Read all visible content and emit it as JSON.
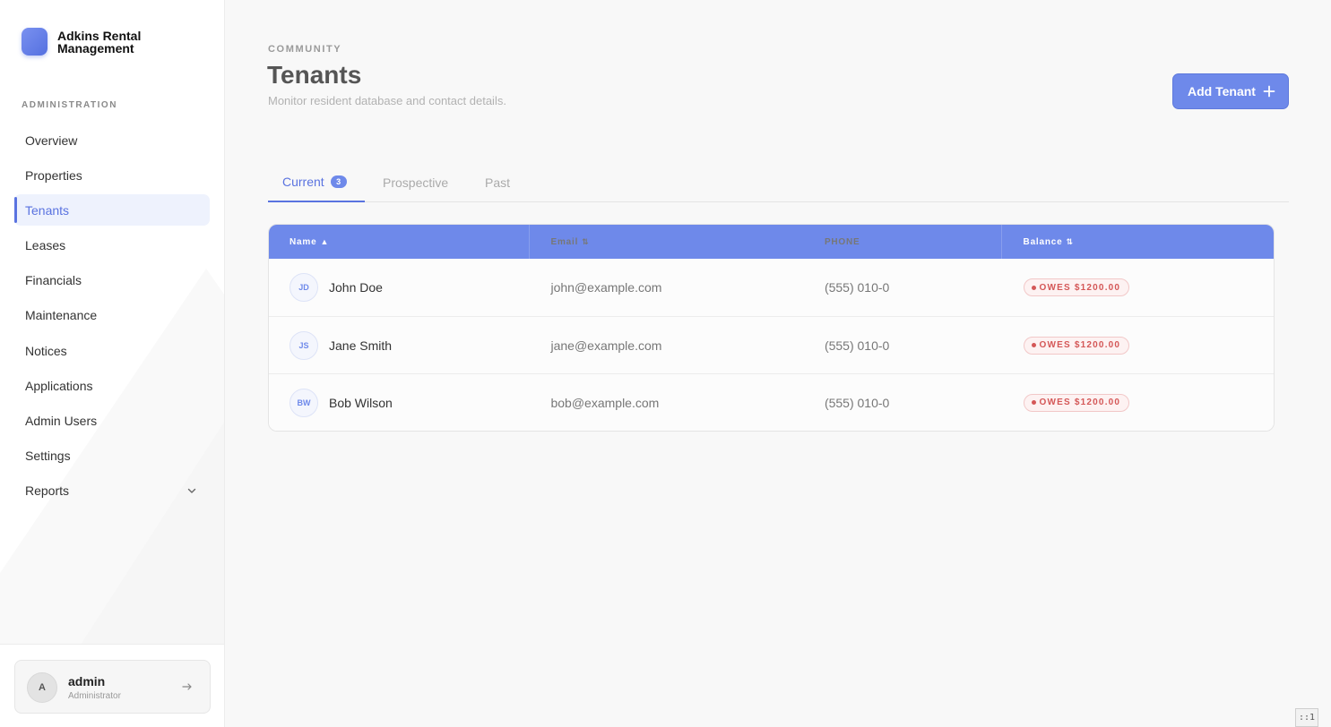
{
  "brand": {
    "name": "Adkins Rental Management"
  },
  "sidebar": {
    "section_label": "ADMINISTRATION",
    "items": [
      {
        "label": "Overview"
      },
      {
        "label": "Properties"
      },
      {
        "label": "Tenants",
        "active": true
      },
      {
        "label": "Leases"
      },
      {
        "label": "Financials"
      },
      {
        "label": "Maintenance"
      },
      {
        "label": "Notices"
      },
      {
        "label": "Applications"
      },
      {
        "label": "Admin Users"
      },
      {
        "label": "Settings"
      },
      {
        "label": "Reports",
        "icon": "chevron-down-icon"
      }
    ]
  },
  "user": {
    "initial": "A",
    "name": "admin",
    "role": "Administrator",
    "logout_icon": "arrow-right-icon"
  },
  "header": {
    "eyebrow": "COMMUNITY",
    "title": "Tenants",
    "subtitle": "Monitor resident database and contact details.",
    "add_button_label": "Add Tenant",
    "add_button_icon": "plus-icon"
  },
  "tabs": [
    {
      "label": "Current",
      "badge": "3",
      "active": true
    },
    {
      "label": "Prospective"
    },
    {
      "label": "Past"
    }
  ],
  "table": {
    "columns": [
      {
        "label": "Name",
        "sort": "▲"
      },
      {
        "label": "Email",
        "sort": "⇅"
      },
      {
        "label": "PHONE"
      },
      {
        "label": "Balance",
        "sort": "⇅"
      }
    ],
    "rows": [
      {
        "initials": "JD",
        "name": "John Doe",
        "email": "john@example.com",
        "phone": "(555) 010-0",
        "balance": "OWES $1200.00"
      },
      {
        "initials": "JS",
        "name": "Jane Smith",
        "email": "jane@example.com",
        "phone": "(555) 010-0",
        "balance": "OWES $1200.00"
      },
      {
        "initials": "BW",
        "name": "Bob Wilson",
        "email": "bob@example.com",
        "phone": "(555) 010-0",
        "balance": "OWES $1200.00"
      }
    ]
  },
  "corner_chip": "::1",
  "colors": {
    "accent": "#6e89ea",
    "active_nav": "#5a73e0",
    "owes": "#d45757"
  }
}
